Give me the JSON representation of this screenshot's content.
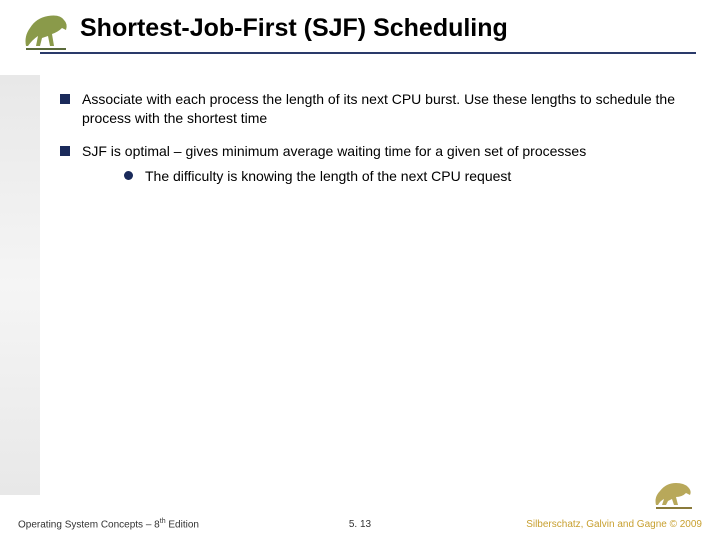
{
  "title": "Shortest-Job-First (SJF) Scheduling",
  "bullets": [
    {
      "text": "Associate with each process the length of its next CPU burst.  Use these lengths to schedule the process with the shortest time"
    },
    {
      "text": "SJF is optimal – gives minimum average waiting time for a given set of processes",
      "sub": "The difficulty is knowing the length of the next CPU request"
    }
  ],
  "footer": {
    "left_prefix": "Operating System Concepts – 8",
    "left_suffix": " Edition",
    "left_sup": "th",
    "center": "5. 13",
    "right": "Silberschatz, Galvin and Gagne © 2009"
  }
}
